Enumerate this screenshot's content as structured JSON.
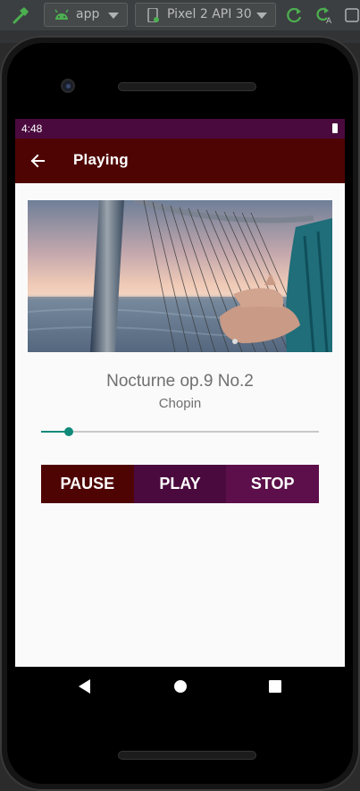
{
  "ide": {
    "run_config": "app",
    "device": "Pixel 2 API 30",
    "icons": [
      "hammer-icon",
      "android-icon",
      "phone-icon",
      "apply-changes-icon",
      "apply-code-changes-icon"
    ],
    "colors": {
      "toolbar": "#3c3f41",
      "icon_green": "#4caf50"
    }
  },
  "status_bar": {
    "time": "4:48",
    "icons": [
      "battery-icon"
    ]
  },
  "app_bar": {
    "title": "Playing",
    "icons": [
      "arrow-back-icon"
    ]
  },
  "player": {
    "song_title": "Nocturne op.9 No.2",
    "artist": "Chopin",
    "progress": 0.1,
    "cover_image": "harp-at-sunset"
  },
  "controls": {
    "pause_label": "PAUSE",
    "play_label": "PLAY",
    "stop_label": "STOP",
    "colors": {
      "pause": "#4f0404",
      "play": "#4a0a3e",
      "stop": "#5c0f4a"
    }
  },
  "nav_bar": {
    "icons": [
      "nav-back-icon",
      "nav-home-icon",
      "nav-recents-icon"
    ]
  },
  "colors": {
    "status_bar": "#4a0a3e",
    "app_bar": "#4f0404",
    "accent": "#0f8a7a",
    "text_secondary": "#6f6f6f"
  }
}
